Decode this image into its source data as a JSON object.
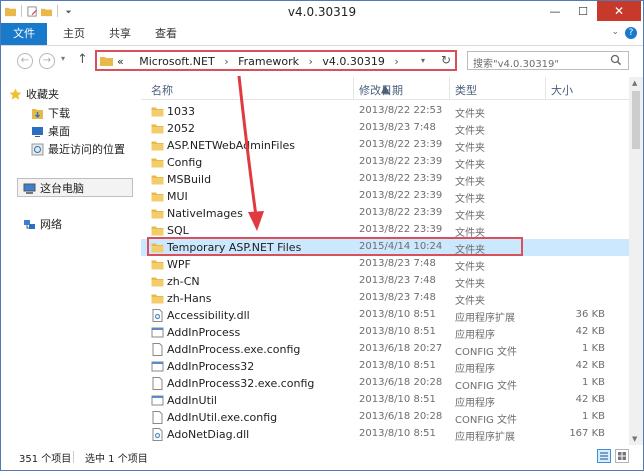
{
  "window": {
    "title": "v4.0.30319",
    "minimize_glyph": "—",
    "maximize_glyph": "☐",
    "close_glyph": "✕"
  },
  "ribbon": {
    "tabs": [
      "文件",
      "主页",
      "共享",
      "查看"
    ],
    "expand_glyph": "⌄",
    "help_glyph": "?"
  },
  "nav": {
    "back_glyph": "←",
    "forward_glyph": "→",
    "recent_glyph": "▾",
    "up_glyph": "↑",
    "address": {
      "overflow": "«",
      "crumbs": [
        "Microsoft.NET",
        "Framework",
        "v4.0.30319"
      ],
      "separator": "›",
      "dropdown_glyph": "▾",
      "refresh_glyph": "↻"
    },
    "search": {
      "placeholder": "搜索\"v4.0.30319\""
    }
  },
  "sidebar": {
    "favorites": "收藏夹",
    "favorites_items": [
      "下载",
      "桌面",
      "最近访问的位置"
    ],
    "this_pc": "这台电脑",
    "network": "网络"
  },
  "columns": {
    "name": "名称",
    "date": "修改日期",
    "type": "类型",
    "size": "大小",
    "sort_glyph": "▲"
  },
  "files": [
    {
      "name": "1033",
      "date": "2013/8/22 22:53",
      "type": "文件夹",
      "size": "",
      "icon": "folder-icon"
    },
    {
      "name": "2052",
      "date": "2013/8/23 7:48",
      "type": "文件夹",
      "size": "",
      "icon": "folder-icon"
    },
    {
      "name": "ASP.NETWebAdminFiles",
      "date": "2013/8/22 23:39",
      "type": "文件夹",
      "size": "",
      "icon": "folder-icon"
    },
    {
      "name": "Config",
      "date": "2013/8/22 23:39",
      "type": "文件夹",
      "size": "",
      "icon": "folder-icon"
    },
    {
      "name": "MSBuild",
      "date": "2013/8/22 23:39",
      "type": "文件夹",
      "size": "",
      "icon": "folder-icon"
    },
    {
      "name": "MUI",
      "date": "2013/8/22 23:39",
      "type": "文件夹",
      "size": "",
      "icon": "folder-icon"
    },
    {
      "name": "NativeImages",
      "date": "2013/8/22 23:39",
      "type": "文件夹",
      "size": "",
      "icon": "folder-icon"
    },
    {
      "name": "SQL",
      "date": "2013/8/22 23:39",
      "type": "文件夹",
      "size": "",
      "icon": "folder-icon"
    },
    {
      "name": "Temporary ASP.NET Files",
      "date": "2015/4/14 10:24",
      "type": "文件夹",
      "size": "",
      "icon": "folder-icon",
      "selected": true
    },
    {
      "name": "WPF",
      "date": "2013/8/23 7:48",
      "type": "文件夹",
      "size": "",
      "icon": "folder-icon"
    },
    {
      "name": "zh-CN",
      "date": "2013/8/23 7:48",
      "type": "文件夹",
      "size": "",
      "icon": "folder-icon"
    },
    {
      "name": "zh-Hans",
      "date": "2013/8/23 7:48",
      "type": "文件夹",
      "size": "",
      "icon": "folder-icon"
    },
    {
      "name": "Accessibility.dll",
      "date": "2013/8/10 8:51",
      "type": "应用程序扩展",
      "size": "36 KB",
      "icon": "dll-file-icon"
    },
    {
      "name": "AddInProcess",
      "date": "2013/8/10 8:51",
      "type": "应用程序",
      "size": "42 KB",
      "icon": "exe-file-icon"
    },
    {
      "name": "AddInProcess.exe.config",
      "date": "2013/6/18 20:27",
      "type": "CONFIG 文件",
      "size": "1 KB",
      "icon": "config-file-icon"
    },
    {
      "name": "AddInProcess32",
      "date": "2013/8/10 8:51",
      "type": "应用程序",
      "size": "42 KB",
      "icon": "exe-file-icon"
    },
    {
      "name": "AddInProcess32.exe.config",
      "date": "2013/6/18 20:28",
      "type": "CONFIG 文件",
      "size": "1 KB",
      "icon": "config-file-icon"
    },
    {
      "name": "AddInUtil",
      "date": "2013/8/10 8:51",
      "type": "应用程序",
      "size": "42 KB",
      "icon": "exe-file-icon"
    },
    {
      "name": "AddInUtil.exe.config",
      "date": "2013/6/18 20:28",
      "type": "CONFIG 文件",
      "size": "1 KB",
      "icon": "config-file-icon"
    },
    {
      "name": "AdoNetDiag.dll",
      "date": "2013/8/10 8:51",
      "type": "应用程序扩展",
      "size": "167 KB",
      "icon": "dll-file-icon"
    }
  ],
  "status": {
    "count": "351 个项目",
    "selected": "选中 1 个项目"
  },
  "colors": {
    "accent": "#1979ca",
    "highlight": "#d9505a",
    "selection": "#cce8ff",
    "folder": "#e8b84a"
  }
}
